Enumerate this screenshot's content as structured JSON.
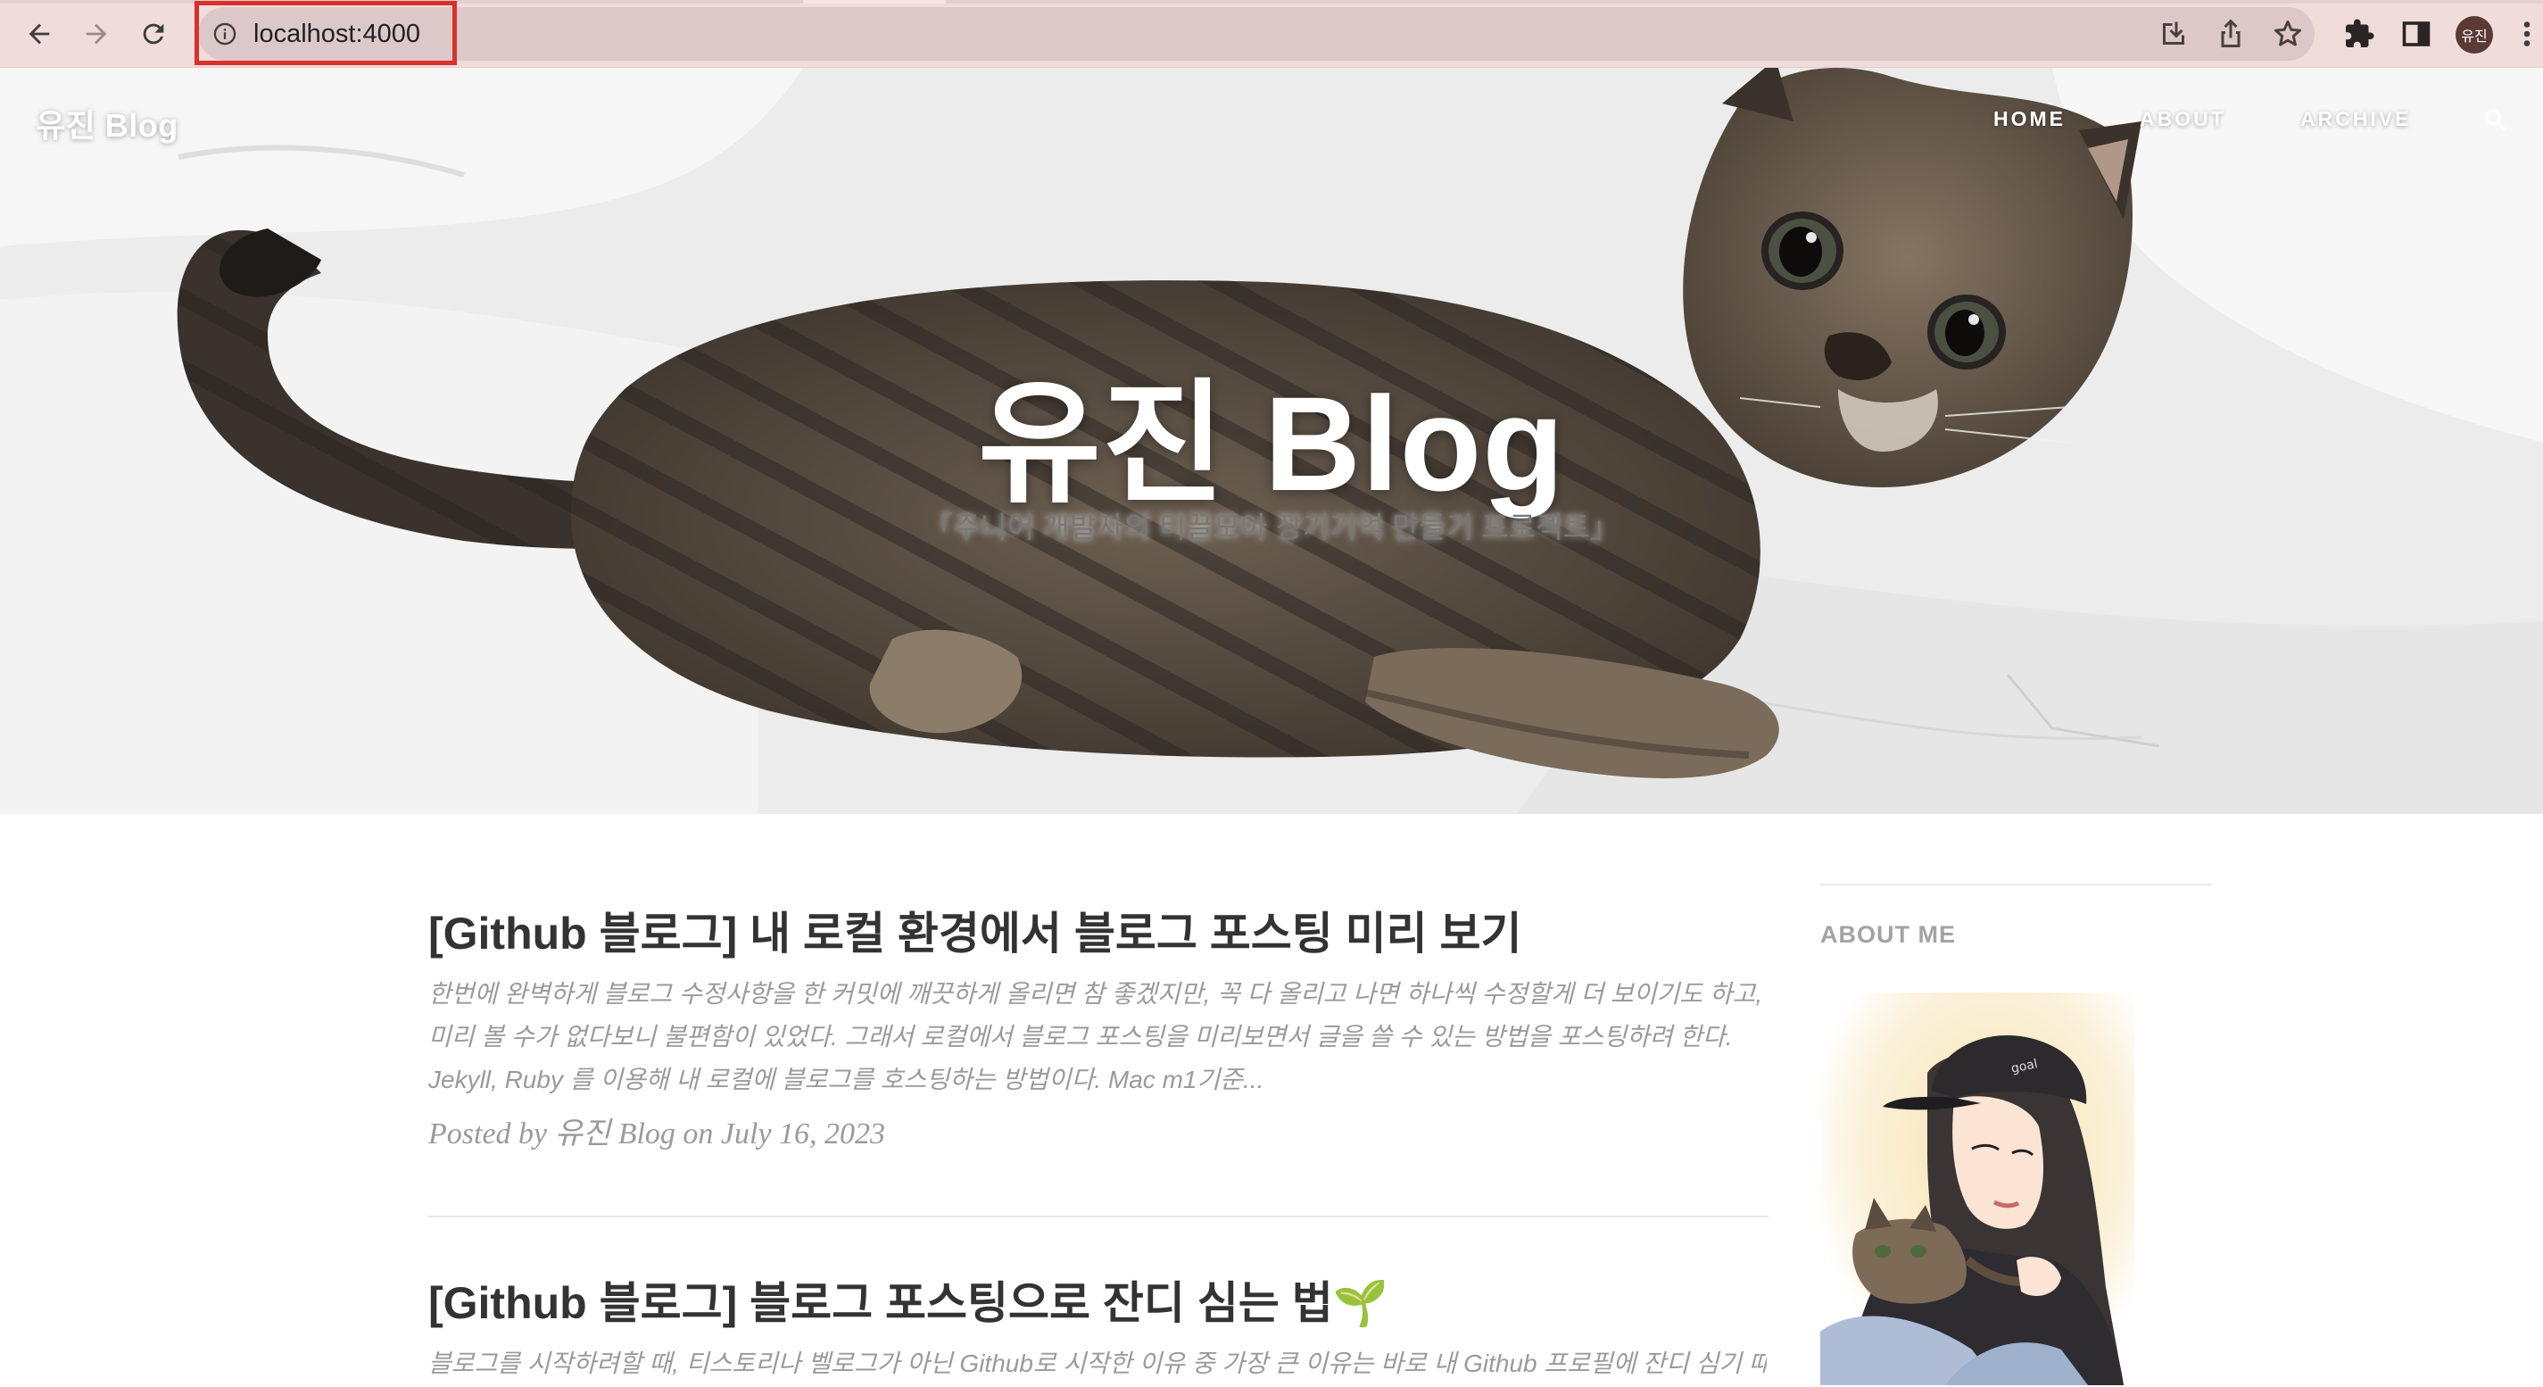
{
  "browser": {
    "url": "localhost:4000",
    "profile_label": "유진",
    "accent_highlight": "#d9302a",
    "toolbar_icons": [
      "back-arrow-icon",
      "forward-arrow-icon",
      "reload-icon",
      "info-icon",
      "install-icon",
      "share-icon",
      "bookmark-star-icon",
      "extensions-puzzle-icon",
      "side-panel-icon",
      "menu-dots-icon"
    ]
  },
  "site": {
    "brand": "유진 Blog",
    "nav": {
      "home": "HOME",
      "about": "ABOUT",
      "archive": "ARCHIVE"
    },
    "hero_title": "유진 Blog",
    "hero_subtitle": "「주니어 개발자의 티끌모아 장기기억 만들기 프로젝트」"
  },
  "posts": [
    {
      "title": "[Github 블로그] 내 로컬 환경에서 블로그 포스팅 미리 보기",
      "excerpt": "한번에 완벽하게 블로그 수정사항을 한 커밋에 깨끗하게 올리면 참 좋겠지만, 꼭 다 올리고 나면 하나씩 수정할게 더 보이기도 하고, 미리 볼 수가 없다보니 불편함이 있었다. 그래서 로컬에서 블로그 포스팅을 미리보면서 글을 쓸 수 있는 방법을 포스팅하려 한다. Jekyll, Ruby 를 이용해 내 로컬에 블로그를 호스팅하는 방법이다. Mac m1기준...",
      "meta": "Posted by 유진 Blog on July 16, 2023"
    },
    {
      "title": "[Github 블로그] 블로그 포스팅으로 잔디 심는 법🌱",
      "excerpt": "블로그를 시작하려할 때, 티스토리나 벨로그가 아닌 Github로 시작한 이유 중 가장 큰 이유는 바로 내 Github 프로필에 잔디 심기 때문이"
    }
  ],
  "sidebar": {
    "about_heading": "ABOUT ME"
  }
}
